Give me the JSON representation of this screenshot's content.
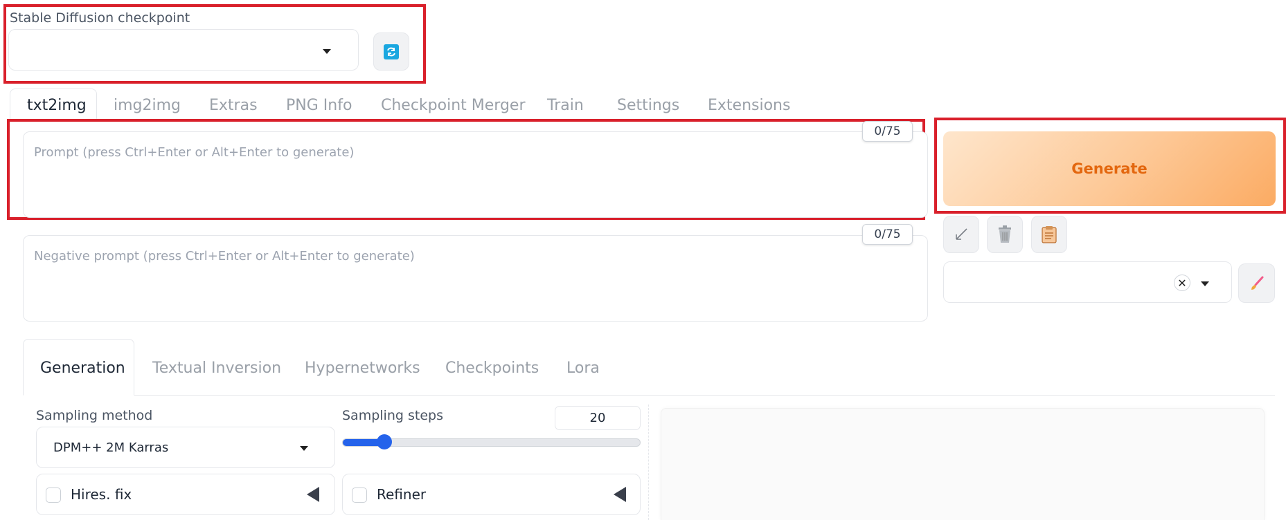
{
  "checkpoint": {
    "label": "Stable Diffusion checkpoint",
    "value": ""
  },
  "top_tabs": [
    "txt2img",
    "img2img",
    "Extras",
    "PNG Info",
    "Checkpoint Merger",
    "Train",
    "Settings",
    "Extensions"
  ],
  "prompt": {
    "placeholder": "Prompt (press Ctrl+Enter or Alt+Enter to generate)",
    "counter": "0/75"
  },
  "negative_prompt": {
    "placeholder": "Negative prompt (press Ctrl+Enter or Alt+Enter to generate)",
    "counter": "0/75"
  },
  "generate": {
    "label": "Generate"
  },
  "sub_tabs": [
    "Generation",
    "Textual Inversion",
    "Hypernetworks",
    "Checkpoints",
    "Lora"
  ],
  "sampling": {
    "method_label": "Sampling method",
    "method_value": "DPM++ 2M Karras",
    "steps_label": "Sampling steps",
    "steps_value": "20",
    "steps_fraction": 0.14
  },
  "accordions": {
    "hires_label": "Hires. fix",
    "refiner_label": "Refiner"
  },
  "colors": {
    "highlight": "#d9202b",
    "generate_text": "#e3670f",
    "accent": "#2563eb"
  }
}
